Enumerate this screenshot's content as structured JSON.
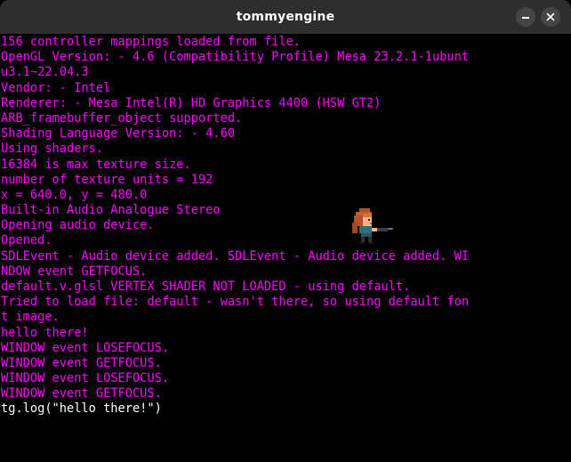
{
  "window": {
    "title": "tommyengine",
    "minimize_icon": "minimize-icon",
    "close_icon": "close-icon"
  },
  "console": {
    "text_color": "#ff00ff",
    "lines": [
      "156 controller mappings loaded from file.",
      "OpenGL Version: - 4.6 (Compatibility Profile) Mesa 23.2.1-1ubunt",
      "u3.1~22.04.3",
      "Vendor: - Intel",
      "Renderer: - Mesa Intel(R) HD Graphics 4400 (HSW GT2)",
      "ARB_framebuffer_object supported.",
      "Shading Language Version: - 4.60",
      "Using shaders.",
      "16384 is max texture size.",
      "number of texture units = 192",
      "x = 640.0, y = 480.0",
      "Built-in Audio Analogue Stereo",
      "Opening audio device.",
      "Opened.",
      "SDLEvent - Audio device added. SDLEvent - Audio device added. WI",
      "NDOW event GETFOCUS.",
      "default.v.glsl VERTEX SHADER NOT LOADED - using default.",
      "Tried to load file: default - wasn't there, so using default fon",
      "t image.",
      "hello there!",
      "WINDOW event LOSEFOCUS.",
      "WINDOW event GETFOCUS.",
      "WINDOW event LOSEFOCUS.",
      "WINDOW event GETFOCUS."
    ]
  },
  "prompt": {
    "input_text": "tg.log(\"hello there!\")",
    "text_color": "#ffffff"
  },
  "sprite": {
    "icon": "character-sprite-icon"
  }
}
